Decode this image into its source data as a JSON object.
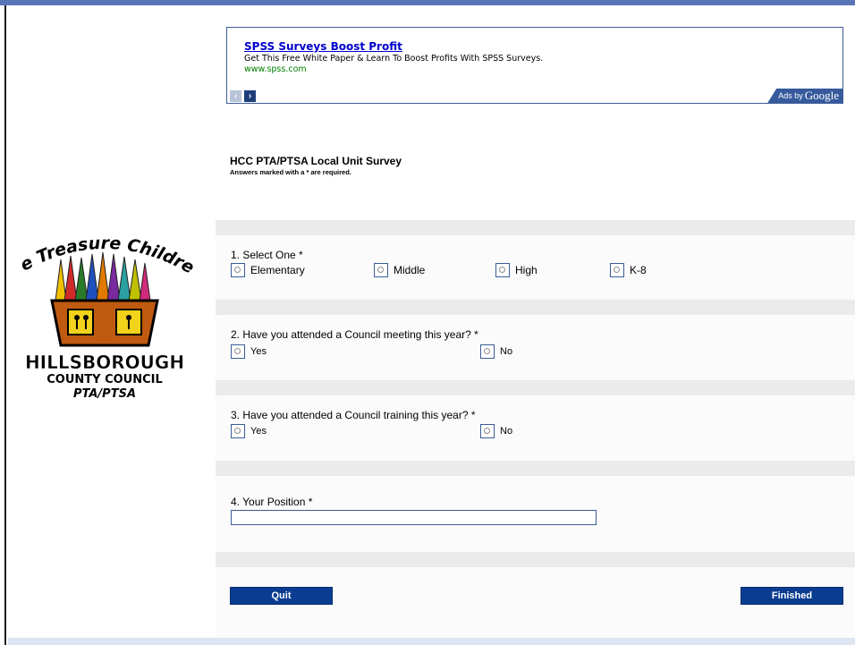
{
  "ad": {
    "title": "SPSS Surveys Boost Profit",
    "text": "Get This Free White Paper & Learn To Boost Profits With SPSS Surveys.",
    "url": "www.spss.com",
    "badge_prefix": "Ads by",
    "badge_brand": "Google"
  },
  "logo": {
    "line1": "We Treasure Children",
    "line2": "HILLSBOROUGH",
    "line3": "COUNTY COUNCIL",
    "line4": "PTA/PTSA"
  },
  "survey": {
    "title": "HCC PTA/PTSA Local Unit Survey",
    "note": "Answers marked with a * are required."
  },
  "questions": [
    {
      "label": "1. Select One *",
      "options": [
        "Elementary",
        "Middle",
        "High",
        "K-8"
      ]
    },
    {
      "label": "2. Have you attended a Council meeting this year? *",
      "options": [
        "Yes",
        "No"
      ]
    },
    {
      "label": "3. Have you attended a Council training this year? *",
      "options": [
        "Yes",
        "No"
      ]
    },
    {
      "label": "4. Your Position *",
      "value": ""
    }
  ],
  "buttons": {
    "quit": "Quit",
    "finished": "Finished"
  },
  "colors": {
    "button_bg": "#0a3d91",
    "ad_border": "#3d5d99",
    "accent": "#5a74b8"
  }
}
